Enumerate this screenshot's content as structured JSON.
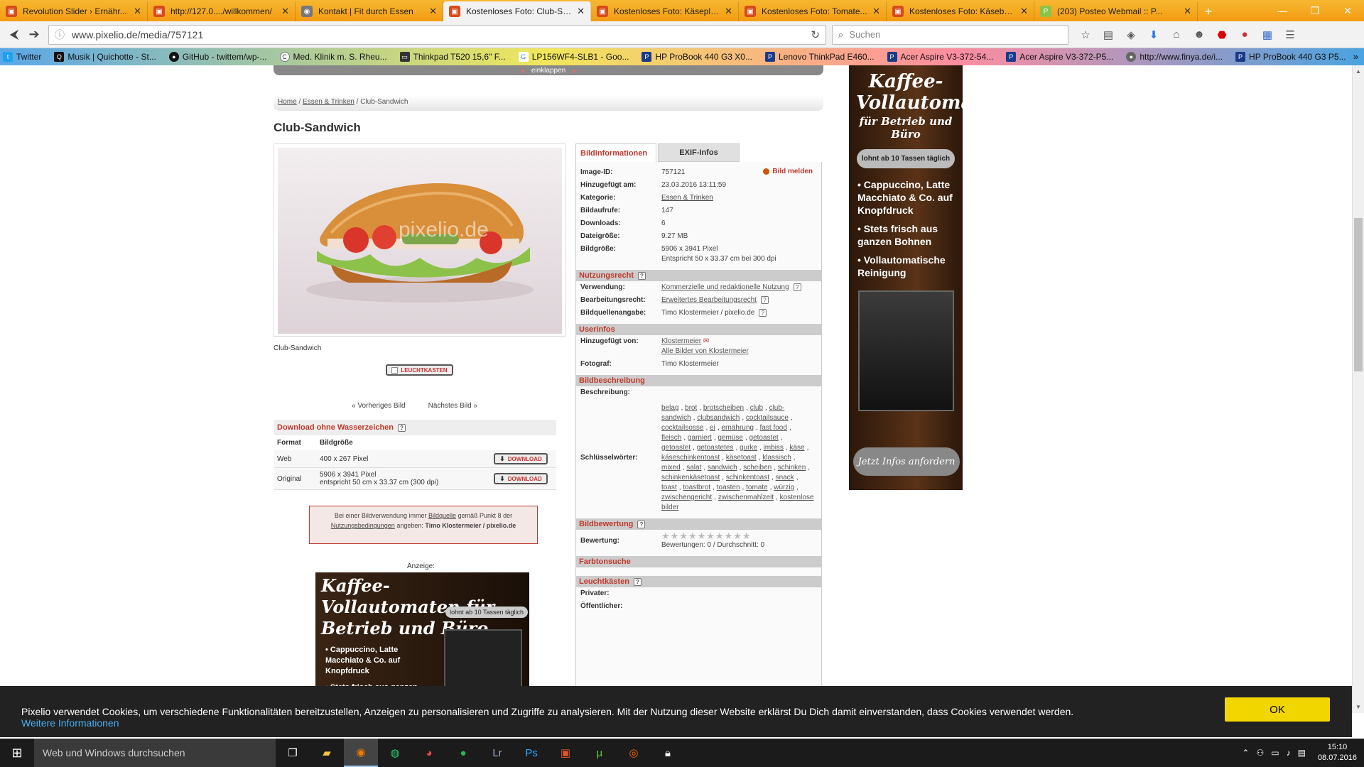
{
  "browser": {
    "tabs": [
      {
        "label": "Revolution Slider › Ernähr...",
        "icon": "revslider-icon",
        "active": false
      },
      {
        "label": "http://127.0..../willkommen/",
        "icon": "page-icon",
        "active": false
      },
      {
        "label": "Kontakt | Fit durch Essen",
        "icon": "globe-icon",
        "active": false
      },
      {
        "label": "Kostenloses Foto: Club-Sa...",
        "icon": "pixelio-icon",
        "active": true
      },
      {
        "label": "Kostenloses Foto: Käseplat...",
        "icon": "pixelio-icon",
        "active": false
      },
      {
        "label": "Kostenloses Foto: Tomate...",
        "icon": "pixelio-icon",
        "active": false
      },
      {
        "label": "Kostenloses Foto: Käsebuf...",
        "icon": "pixelio-icon",
        "active": false
      },
      {
        "label": "(203) Posteo Webmail :: P...",
        "icon": "posteo-icon",
        "active": false
      }
    ],
    "url": "www.pixelio.de/media/757121",
    "search_placeholder": "Suchen",
    "bookmarks": [
      {
        "label": "Twitter",
        "icon": "twitter-icon"
      },
      {
        "label": "Musik | Quichotte - St...",
        "icon": "q-icon"
      },
      {
        "label": "GitHub - twittem/wp-...",
        "icon": "github-icon"
      },
      {
        "label": "Med. Klinik m. S. Rheu...",
        "icon": "c-icon"
      },
      {
        "label": "Thinkpad T520 15,6\" F...",
        "icon": "laptop-icon"
      },
      {
        "label": "LP156WF4-SLB1 - Goo...",
        "icon": "google-icon"
      },
      {
        "label": "HP ProBook 440 G3 X0...",
        "icon": "p-icon"
      },
      {
        "label": "Lenovo ThinkPad E460...",
        "icon": "p-icon"
      },
      {
        "label": "Acer Aspire V3-372-54...",
        "icon": "p-icon"
      },
      {
        "label": "Acer Aspire V3-372-P5...",
        "icon": "p-icon"
      },
      {
        "label": "http://www.finya.de/i...",
        "icon": "finya-icon"
      },
      {
        "label": "HP ProBook 440 G3 P5...",
        "icon": "hp-icon"
      }
    ]
  },
  "page": {
    "collapse_label": "einklappen",
    "breadcrumb": {
      "home": "Home",
      "category": "Essen & Trinken",
      "current": "Club-Sandwich"
    },
    "title": "Club-Sandwich",
    "image_caption": "Club-Sandwich",
    "watermark": "pixelio.de",
    "lightbox_label": "LEUCHTKASTEN",
    "prev_label": "« Vorheriges Bild",
    "next_label": "Nächstes Bild »",
    "download": {
      "heading": "Download ohne Wasserzeichen",
      "col_format": "Format",
      "col_size": "Bildgröße",
      "rows": [
        {
          "format": "Web",
          "size": "400 x 267 Pixel",
          "size2": "",
          "button": "DOWNLOAD"
        },
        {
          "format": "Original",
          "size": "5906 x 3941 Pixel",
          "size2": "entspricht 50 cm x 33.37 cm (300 dpi)",
          "button": "DOWNLOAD"
        }
      ]
    },
    "credit": {
      "t1": "Bei einer Bildverwendung immer",
      "link1": "Bildquelle",
      "t2": "gemäß Punkt 8 der",
      "link2": "Nutzungsbedingungen",
      "t3": "angeben:",
      "author": "Timo Klostermeier / pixelio.de"
    },
    "ad_label": "Anzeige:",
    "ad_bottom": {
      "title": "Kaffee-Vollautomaten für Betrieb und Büro",
      "badge": "lohnt ab 10 Tassen täglich",
      "bullet1": "• Cappuccino, Latte Macchiato & Co. auf Knopfdruck",
      "bullet2": "• Stets frisch aus ganzen Bohnen"
    },
    "info": {
      "tab_info": "Bildinformationen",
      "tab_exif": "EXIF-Infos",
      "report": "Bild melden",
      "rows": [
        {
          "k": "Image-ID:",
          "v": "757121"
        },
        {
          "k": "Hinzugefügt am:",
          "v": "23.03.2016 13:11:59"
        },
        {
          "k": "Kategorie:",
          "v": "Essen & Trinken"
        },
        {
          "k": "Bildaufrufe:",
          "v": "147"
        },
        {
          "k": "Downloads:",
          "v": "6"
        },
        {
          "k": "Dateigröße:",
          "v": "9.27 MB"
        },
        {
          "k": "Bildgröße:",
          "v": "5906 x 3941 Pixel"
        }
      ],
      "size_note": "Entspricht 50 x 33.37 cm bei 300 dpi",
      "usage_heading": "Nutzungsrecht",
      "usage": [
        {
          "k": "Verwendung:",
          "v": "Kommerzielle und redaktionelle Nutzung"
        },
        {
          "k": "Bearbeitungsrecht:",
          "v": "Erweitertes Bearbeitungsrecht"
        },
        {
          "k": "Bildquellenangabe:",
          "v": "Timo Klostermeier / pixelio.de"
        }
      ],
      "user_heading": "Userinfos",
      "added_by_k": "Hinzugefügt von:",
      "added_by_v": "Klostermeier",
      "all_images": "Alle Bilder von Klostermeier",
      "photographer_k": "Fotograf:",
      "photographer_v": "Timo Klostermeier",
      "desc_heading": "Bildbeschreibung",
      "desc_k": "Beschreibung:",
      "keywords_k": "Schlüsselwörter:",
      "keywords": [
        "belag",
        "brot",
        "brotscheiben",
        "club",
        "club-sandwich",
        "clubsandwich",
        "cocktailsauce",
        "cocktailsosse",
        "ei",
        "ernährung",
        "fast food",
        "fleisch",
        "garniert",
        "gemüse",
        "getoastet",
        "getoastet",
        "getoastetes",
        "gurke",
        "imbiss",
        "käse",
        "käseschinkentoast",
        "käsetoast",
        "klassisch",
        "mixed",
        "salat",
        "sandwich",
        "scheiben",
        "schinken",
        "schinkenkäsetoast",
        "schinkentoast",
        "snack",
        "toast",
        "toastbrot",
        "toasten",
        "tomate",
        "würzig",
        "zwischengericht",
        "zwischenmahlzeit",
        "kostenlose bilder"
      ],
      "rating_heading": "Bildbewertung",
      "rating_k": "Bewertung:",
      "rating_text": "Bewertungen: 0 / Durchschnitt: 0",
      "color_heading": "Farbtonsuche",
      "lightbox_heading": "Leuchtkästen",
      "private_k": "Privater:",
      "public_k": "Öffentlicher:"
    },
    "ad_right": {
      "title": "Kaffee-Vollautomaten",
      "subtitle": "für Betrieb und Büro",
      "badge": "lohnt ab 10 Tassen täglich",
      "bullets": [
        "• Cappuccino, Latte Macchiato & Co. auf Knopfdruck",
        "• Stets frisch aus ganzen Bohnen",
        "• Vollautomatische Reinigung"
      ],
      "cta": "Jetzt Infos anfordern"
    }
  },
  "cookie": {
    "text": "Pixelio verwendet Cookies, um verschiedene Funktionalitäten bereitzustellen, Anzeigen zu personalisieren und Zugriffe zu analysieren. Mit der Nutzung dieser Website erklärst Du Dich damit einverstanden, dass Cookies verwendet werden.",
    "more": "Weitere Informationen",
    "ok": "OK"
  },
  "taskbar": {
    "search_placeholder": "Web und Windows durchsuchen",
    "time": "15:10",
    "date": "08.07.2016"
  }
}
